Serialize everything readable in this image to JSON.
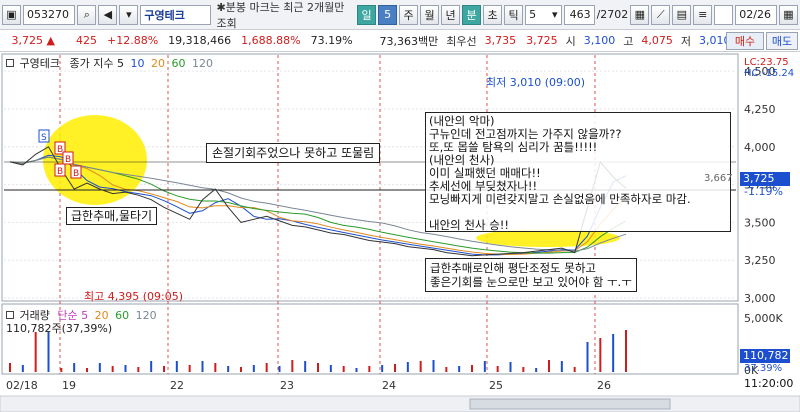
{
  "toolbar": {
    "stock_code": "053270",
    "stock_name": "구영테크",
    "notice": "분봉 마크는 최근 2개월만 조회",
    "period_buttons": [
      "일",
      "5",
      "주",
      "월",
      "년",
      "분",
      "초",
      "틱"
    ],
    "interval_value": "5",
    "counter": "463",
    "counter_total": "/2702",
    "date": "02/26"
  },
  "quote": {
    "price": "3,725",
    "change": "425",
    "change_pct": "+12.88%",
    "volume": "19,318,466",
    "volume_pct": "1,688.88%",
    "turnover_pct": "73.19%",
    "amount": "73,363백만",
    "best_label": "최우선",
    "best_ask": "3,735",
    "best_bid": "3,725",
    "open_label": "시",
    "open": "3,100",
    "high_label": "고",
    "high": "4,075",
    "low_label": "저",
    "low": "3,010",
    "buy_label": "매수",
    "sell_label": "매도"
  },
  "legend": {
    "name": "구영테크",
    "ma_label": "종가 지수 5",
    "ma_periods": [
      "10",
      "20",
      "60",
      "120"
    ],
    "ma_colors": [
      "#1c4fd0",
      "#e08a1e",
      "#2a9b2a",
      "#7b8796"
    ],
    "vol_label": "거래량",
    "vol_ma_label": "단순 5",
    "vol_ma_periods": [
      "20",
      "60",
      "120"
    ],
    "vol_value": "110,782주(37,39%)"
  },
  "annotations": {
    "min_label": "최저 3,010 (09:00)",
    "max_label": "최고 4,395 (09:05)",
    "box1": "급한추매,물타기",
    "box2": "손절기회주었으나 못하고 또물림",
    "box3": "(내안의 악마)\n구뉴인데 전고점까지는 가주지 않을까??\n또,또 몹쓸 탐욕의 심리가 꿈틀!!!!!\n(내안의 천사)\n이미 실패했던 매매다!!\n추세선에 부딪쳤자나!!\n모닝빠지게 미련갖지말고 손실없음에 만족하자로 마감.\n\n내안의 천사 승!!",
    "box4": "급한추매로인해 평단조정도 못하고\n좋은기회를 눈으로만 보고 있어야 함 ㅜ.ㅜ",
    "marker_value": "3,667"
  },
  "axis": {
    "price_ticks": [
      "4,500",
      "4,250",
      "4,000",
      "3,750",
      "3,500",
      "3,250",
      "3,000"
    ],
    "lc": "LC:23.75",
    "hc": "HC:-15.24",
    "price_tag": "3,725",
    "price_tag_pct": "-1.19%",
    "vol_ticks": [
      "5,000K",
      "0K"
    ],
    "vol_tag": "110,782",
    "vol_tag_pct": "37.39%",
    "time_labels": [
      "02/18",
      "19",
      "22",
      "23",
      "24",
      "25",
      "26"
    ],
    "time_right": "11:20:00"
  },
  "chart_data": {
    "type": "line",
    "title": "",
    "ylabel": "",
    "ylim": [
      3000,
      4600
    ],
    "days": [
      "02/18",
      "19",
      "22",
      "23",
      "24",
      "25",
      "26"
    ],
    "series": [
      {
        "name": "종가",
        "values": [
          3900,
          3880,
          3950,
          4000,
          3850,
          3720,
          3760,
          3720,
          3690,
          3700,
          3680,
          3650,
          3600,
          3560,
          3520,
          3650,
          3720,
          3600,
          3500,
          3520,
          3540,
          3510,
          3480,
          3470,
          3450,
          3430,
          3420,
          3400,
          3380,
          3370,
          3360,
          3340,
          3330,
          3320,
          3300,
          3290,
          3280,
          3285,
          3290,
          3295,
          3300,
          3310,
          3320,
          3330,
          3300,
          3600,
          3900,
          3800,
          3725
        ]
      }
    ],
    "volume_max": 5000
  },
  "colors": {
    "up": "#d01c1c",
    "down": "#1c4fd0",
    "highlight": "#ffee00",
    "grid_day": "#d02a2a"
  }
}
